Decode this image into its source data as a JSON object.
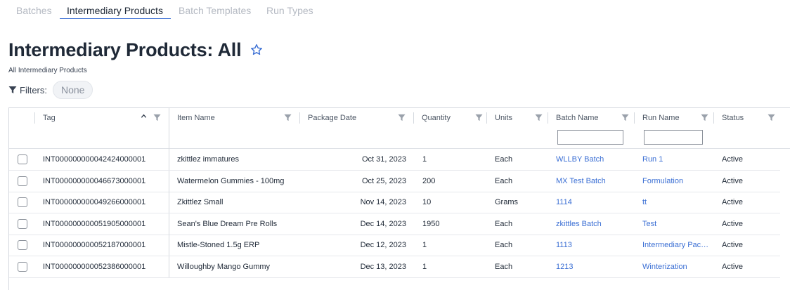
{
  "tabs": [
    {
      "label": "Batches",
      "active": false
    },
    {
      "label": "Intermediary Products",
      "active": true
    },
    {
      "label": "Batch Templates",
      "active": false
    },
    {
      "label": "Run Types",
      "active": false
    }
  ],
  "page": {
    "title": "Intermediary Products: All",
    "subtitle": "All Intermediary Products",
    "favorite_icon": "star-outline-icon"
  },
  "filters": {
    "label": "Filters:",
    "value": "None",
    "icon": "funnel-icon"
  },
  "grid": {
    "columns": [
      {
        "key": "select",
        "label": ""
      },
      {
        "key": "tag",
        "label": "Tag",
        "sort": "ascending"
      },
      {
        "key": "item_name",
        "label": "Item Name"
      },
      {
        "key": "package_date",
        "label": "Package Date"
      },
      {
        "key": "quantity",
        "label": "Quantity"
      },
      {
        "key": "units",
        "label": "Units"
      },
      {
        "key": "batch_name",
        "label": "Batch Name",
        "filter_input": ""
      },
      {
        "key": "run_name",
        "label": "Run Name",
        "filter_input": ""
      },
      {
        "key": "status",
        "label": "Status"
      }
    ],
    "rows": [
      {
        "tag": "INT000000000042424000001",
        "item_name": "zkittlez immatures",
        "package_date": "Oct 31, 2023",
        "quantity": "1",
        "units": "Each",
        "batch_name": "WLLBY Batch",
        "run_name": "Run 1",
        "status": "Active"
      },
      {
        "tag": "INT000000000046673000001",
        "item_name": "Watermelon Gummies - 100mg",
        "package_date": "Oct 25, 2023",
        "quantity": "200",
        "units": "Each",
        "batch_name": "MX Test Batch",
        "run_name": "Formulation",
        "status": "Active"
      },
      {
        "tag": "INT000000000049266000001",
        "item_name": "Zkittlez Small",
        "package_date": "Nov 14, 2023",
        "quantity": "10",
        "units": "Grams",
        "batch_name": "1114",
        "run_name": "tt",
        "status": "Active"
      },
      {
        "tag": "INT000000000051905000001",
        "item_name": "Sean's Blue Dream Pre Rolls",
        "package_date": "Dec 14, 2023",
        "quantity": "1950",
        "units": "Each",
        "batch_name": "zkittles Batch",
        "run_name": "Test",
        "status": "Active"
      },
      {
        "tag": "INT000000000052187000001",
        "item_name": "Mistle-Stoned 1.5g ERP",
        "package_date": "Dec 12, 2023",
        "quantity": "1",
        "units": "Each",
        "batch_name": "1113",
        "run_name": "Intermediary Pack...",
        "status": "Active"
      },
      {
        "tag": "INT000000000052386000001",
        "item_name": "Willoughby Mango Gummy",
        "package_date": "Dec 13, 2023",
        "quantity": "1",
        "units": "Each",
        "batch_name": "1213",
        "run_name": "Winterization",
        "status": "Active"
      }
    ]
  },
  "colors": {
    "accent": "#3b6fd4",
    "text": "#1f2937",
    "muted_tab": "#b4b9c2",
    "border": "#d5d9df"
  }
}
